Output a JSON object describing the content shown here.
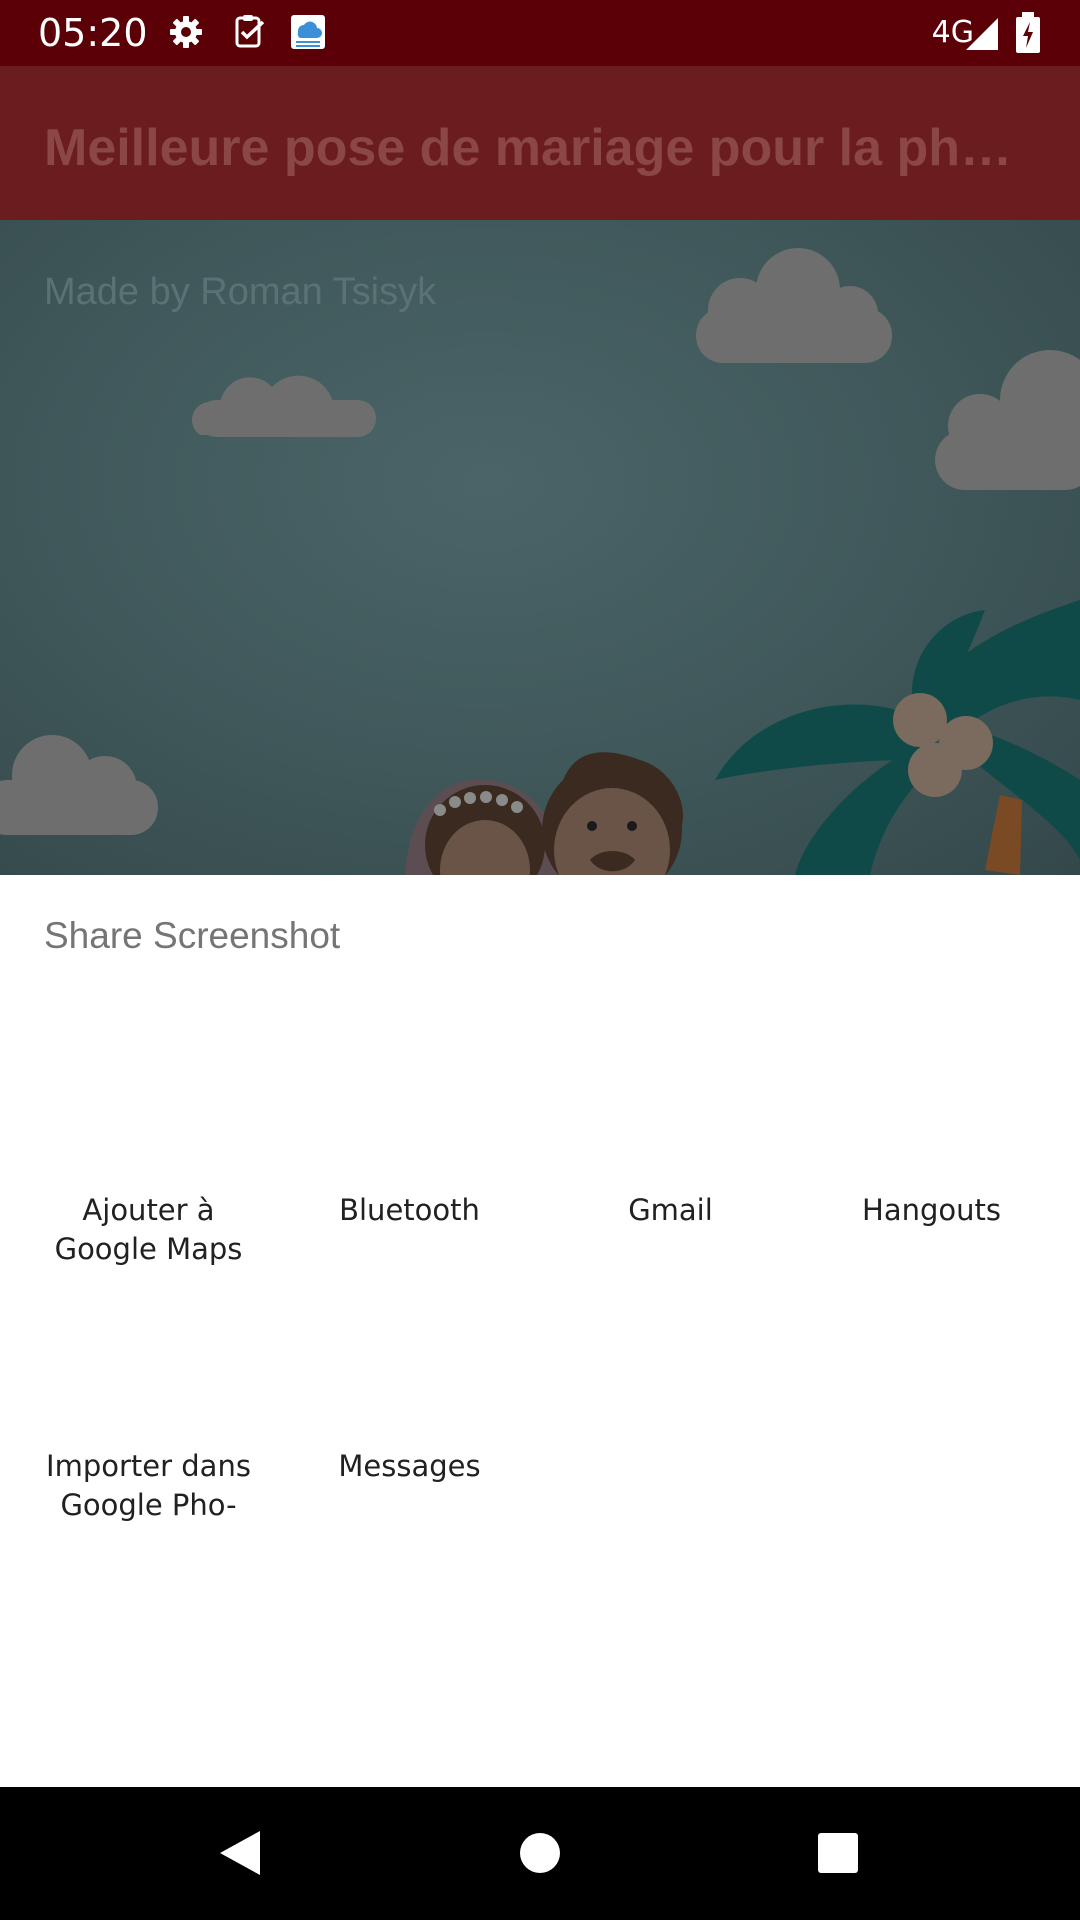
{
  "status_bar": {
    "time": "05:20",
    "network": "4G",
    "icons": [
      "settings-gear-icon",
      "task-check-icon",
      "cloud-app-icon",
      "signal-icon",
      "battery-charging-icon"
    ]
  },
  "app_bar": {
    "title": "Meilleure pose de mariage pour la ph…"
  },
  "content": {
    "made_by": "Made by Roman Tsisyk"
  },
  "share_sheet": {
    "title": "Share Screenshot",
    "targets": [
      {
        "line1": "Ajouter à",
        "line2": "Google Maps"
      },
      {
        "line1": "Bluetooth",
        "line2": ""
      },
      {
        "line1": "Gmail",
        "line2": ""
      },
      {
        "line1": "Hangouts",
        "line2": ""
      },
      {
        "line1": "Importer dans",
        "line2": "Google Pho-"
      },
      {
        "line1": "Messages",
        "line2": ""
      }
    ]
  },
  "nav_bar": {
    "icons": [
      "back-icon",
      "home-icon",
      "recents-icon"
    ]
  }
}
